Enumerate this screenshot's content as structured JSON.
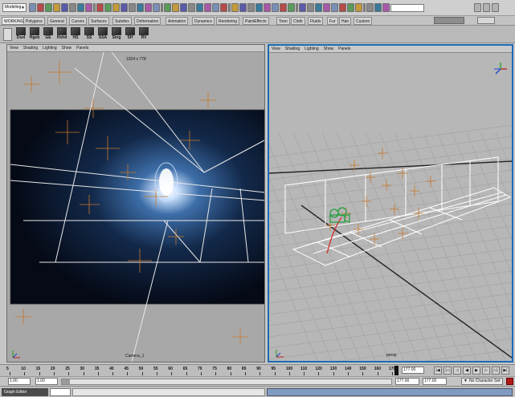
{
  "status_line": {
    "mode": "Modeling",
    "command_field_value": ""
  },
  "shelf_tabs": [
    "WORKING",
    "Polygons",
    "General",
    "Curves",
    "Surfaces",
    "Subdivs",
    "Deformation",
    "Animation",
    "Dynamics",
    "Rendering",
    "PaintEffects",
    "Toon",
    "Cloth",
    "Fluids",
    "Fur",
    "Hair",
    "Custom"
  ],
  "shelf_buttons": [
    "Dsel",
    "Hgeb",
    "GE",
    "Hshd",
    "HS",
    "SS",
    "SSA",
    "Sing",
    "SH",
    "RV"
  ],
  "left_panel": {
    "menu": [
      "View",
      "Shading",
      "Lighting",
      "Show",
      "Panels"
    ],
    "resolution": "1024 x 778",
    "camera": "Camera_1"
  },
  "right_panel": {
    "menu": [
      "View",
      "Shading",
      "Lighting",
      "Show",
      "Panels"
    ],
    "camera": "persp"
  },
  "time_slider": {
    "ticks": [
      "5",
      "10",
      "15",
      "20",
      "25",
      "30",
      "35",
      "40",
      "45",
      "50",
      "55",
      "60",
      "65",
      "70",
      "75",
      "80",
      "85",
      "90",
      "95",
      "100",
      "110",
      "120",
      "130",
      "140",
      "150",
      "160",
      "170"
    ],
    "current_time": "177.00",
    "current_frame": 177
  },
  "range_slider": {
    "start_time": "1.00",
    "playback_start": "1.00",
    "playback_end": "177.00",
    "end_time": "177.00",
    "character_set": "No Character Set"
  },
  "command_line": {
    "window_label": "Graph Editor"
  },
  "colors": {
    "active_panel_border": "#1e6bb7",
    "locator": "#c8782a",
    "camera_green": "#1f9e3a",
    "curve_red": "#d03030"
  }
}
